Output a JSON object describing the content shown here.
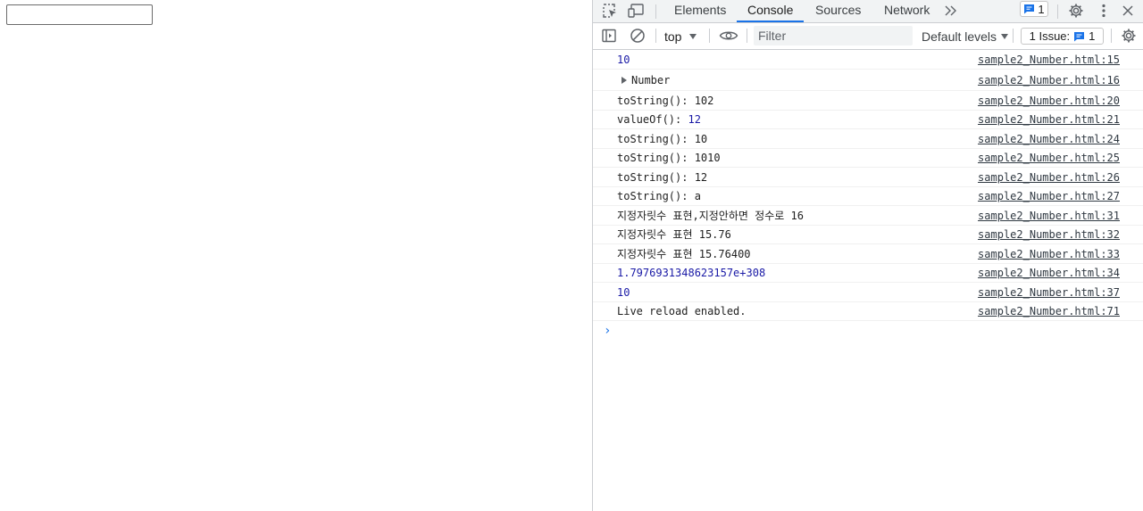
{
  "page": {
    "input_value": ""
  },
  "devtools": {
    "tabs": [
      {
        "label": "Elements",
        "active": false
      },
      {
        "label": "Console",
        "active": true
      },
      {
        "label": "Sources",
        "active": false
      },
      {
        "label": "Network",
        "active": false
      }
    ],
    "message_badge_count": "1",
    "console_toolbar": {
      "context": "top",
      "filter_placeholder": "Filter",
      "levels_label": "Default levels",
      "issues_label": "1 Issue:",
      "issues_count": "1"
    },
    "logs": [
      {
        "message": "10",
        "type": "number",
        "source": "sample2_Number.html:15"
      },
      {
        "message": "Number",
        "type": "object",
        "source": "sample2_Number.html:16"
      },
      {
        "message": "toString(): 102",
        "type": "text",
        "source": "sample2_Number.html:20"
      },
      {
        "message": "valueOf(): ",
        "value": "12",
        "type": "text-number",
        "source": "sample2_Number.html:21"
      },
      {
        "message": "toString(): 10",
        "type": "text",
        "source": "sample2_Number.html:24"
      },
      {
        "message": "toString(): 1010",
        "type": "text",
        "source": "sample2_Number.html:25"
      },
      {
        "message": "toString(): 12",
        "type": "text",
        "source": "sample2_Number.html:26"
      },
      {
        "message": "toString(): a",
        "type": "text",
        "source": "sample2_Number.html:27"
      },
      {
        "message": "지정자릿수 표현,지정안하면 정수로 16",
        "type": "text",
        "source": "sample2_Number.html:31"
      },
      {
        "message": "지정자릿수 표현 15.76",
        "type": "text",
        "source": "sample2_Number.html:32"
      },
      {
        "message": "지정자릿수 표현 15.76400",
        "type": "text",
        "source": "sample2_Number.html:33"
      },
      {
        "message": "1.7976931348623157e+308",
        "type": "number",
        "source": "sample2_Number.html:34"
      },
      {
        "message": "10",
        "type": "number",
        "source": "sample2_Number.html:37"
      },
      {
        "message": "Live reload enabled.",
        "type": "text",
        "source": "sample2_Number.html:71"
      }
    ],
    "colors": {
      "accent": "#1a73e8",
      "number": "#1a1aa6",
      "toolbar_bg": "#f1f3f4"
    }
  }
}
